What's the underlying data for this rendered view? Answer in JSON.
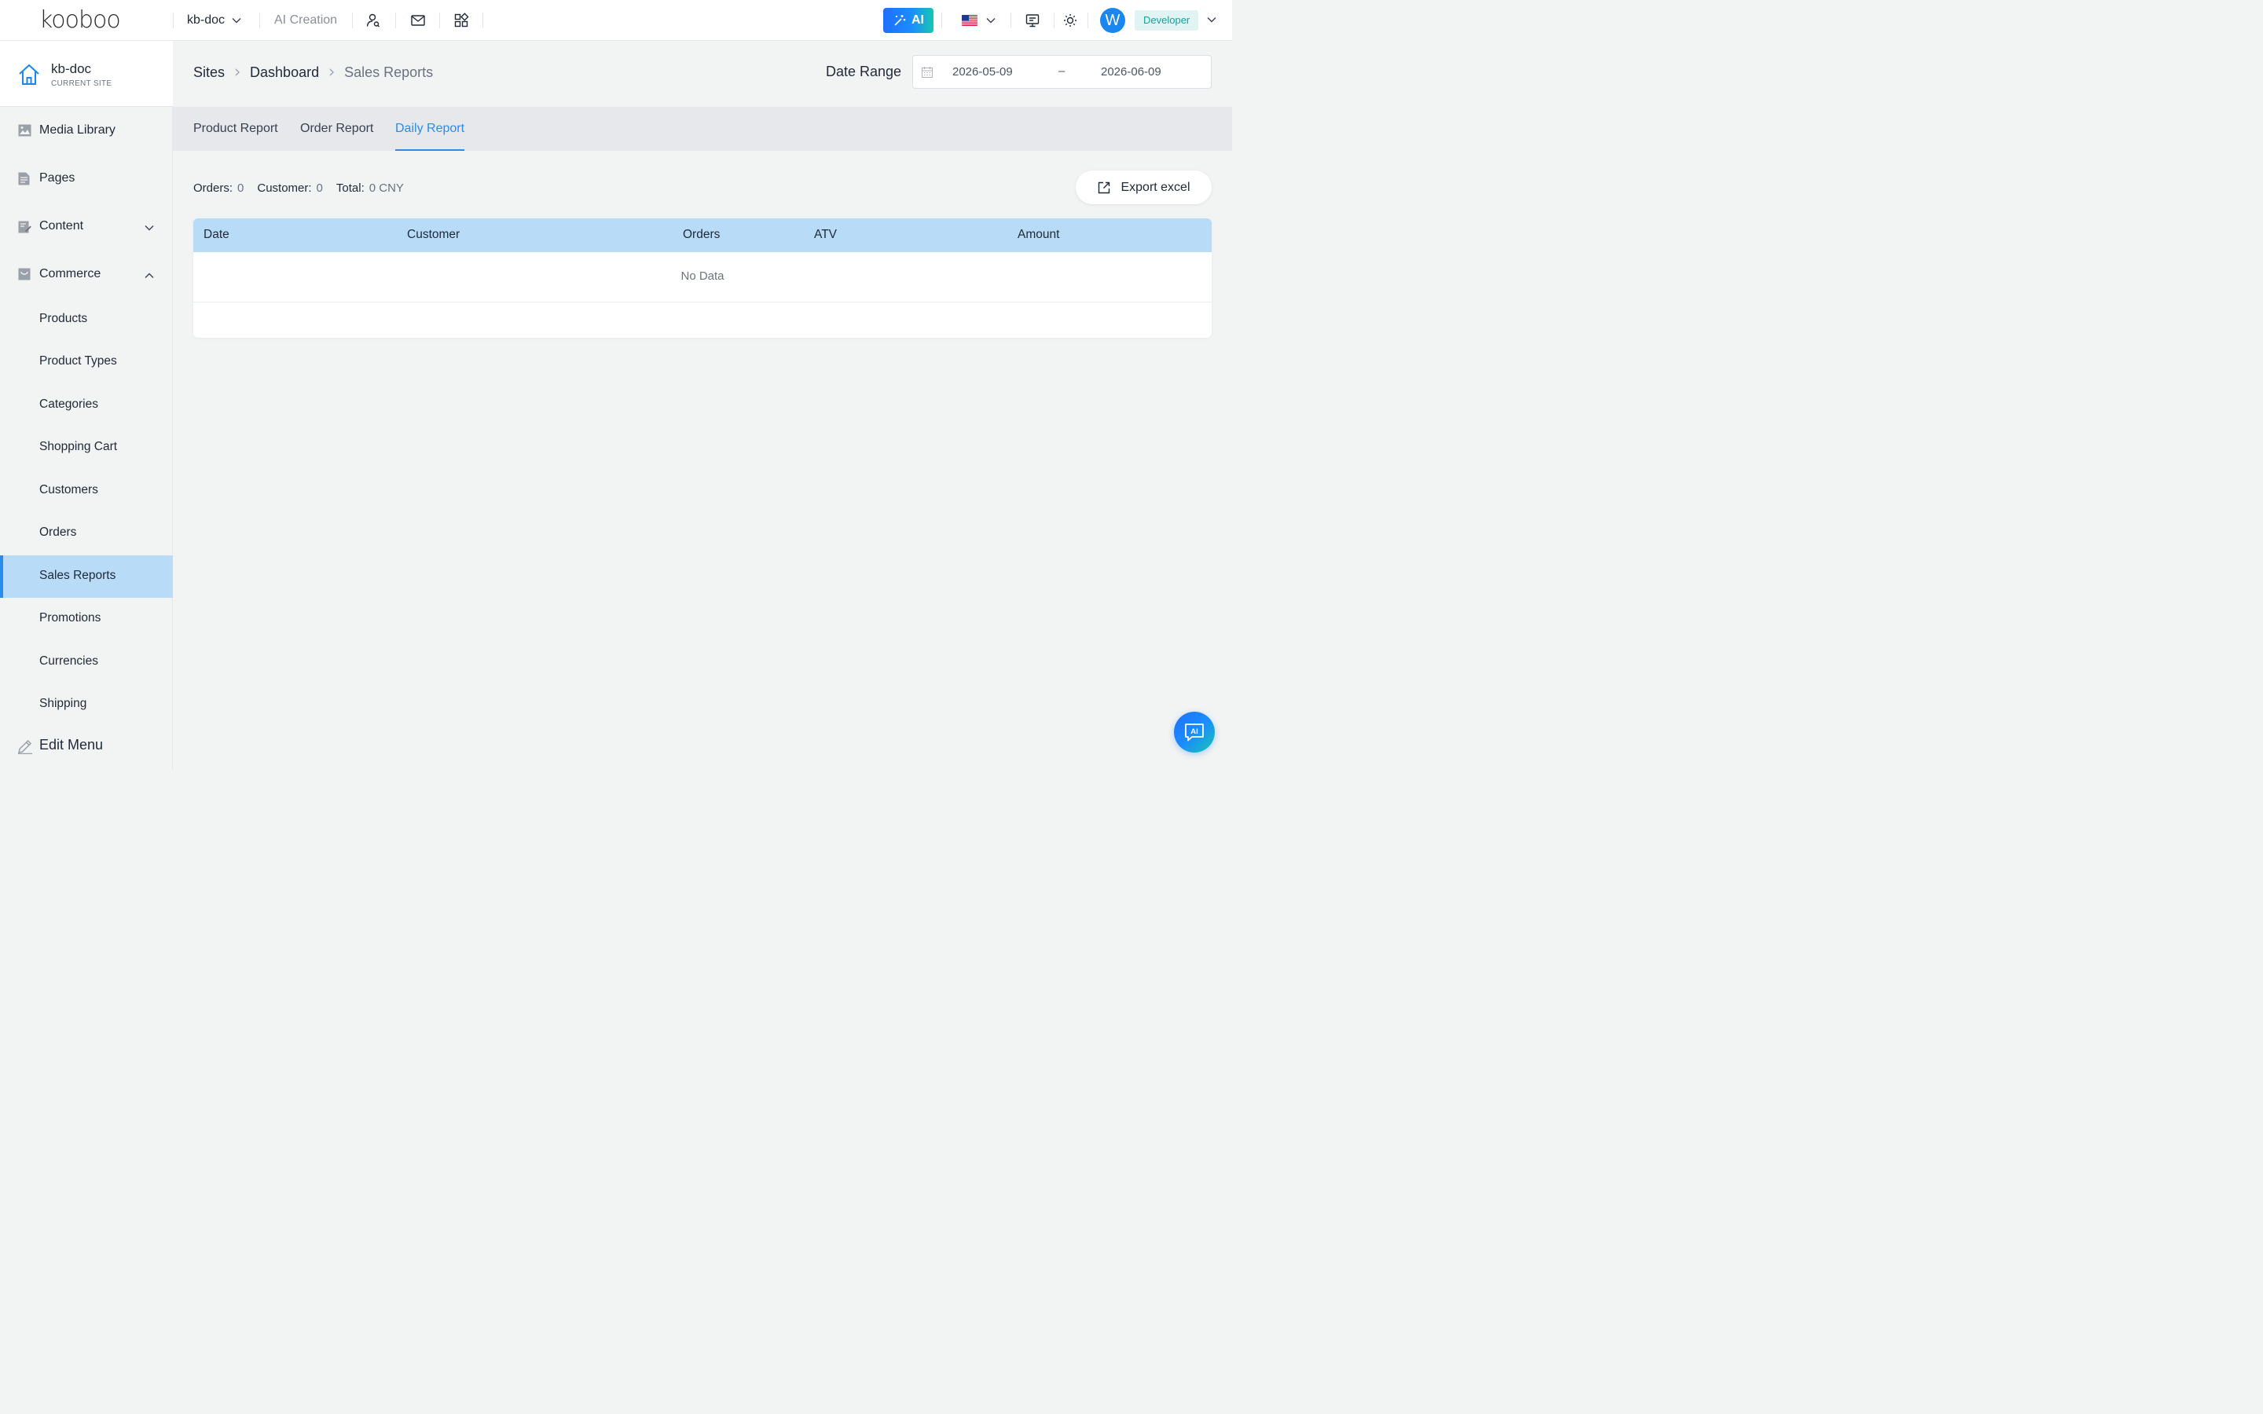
{
  "header": {
    "logo": "kooboo",
    "site_selector": "kb-doc",
    "ai_creation": "AI Creation",
    "ai_button": "AI",
    "user_initial": "W",
    "role": "Developer",
    "accent": "#1a86f0"
  },
  "sidebar": {
    "current_site": {
      "name": "kb-doc",
      "caption": "CURRENT SITE"
    },
    "items": [
      {
        "label": "Media Library",
        "icon": "image-icon"
      },
      {
        "label": "Pages",
        "icon": "document-icon"
      },
      {
        "label": "Content",
        "icon": "edit-document-icon",
        "expanded": false
      },
      {
        "label": "Commerce",
        "icon": "shop-icon",
        "expanded": true
      }
    ],
    "commerce_items": [
      "Products",
      "Product Types",
      "Categories",
      "Shopping Cart",
      "Customers",
      "Orders",
      "Sales Reports",
      "Promotions",
      "Currencies",
      "Shipping"
    ],
    "active_item": "Sales Reports",
    "edit_menu": "Edit Menu"
  },
  "breadcrumb": {
    "items": [
      "Sites",
      "Dashboard"
    ],
    "current": "Sales Reports"
  },
  "date_range": {
    "label": "Date Range",
    "start": "2026-05-09",
    "separator": "–",
    "end": "2026-06-09"
  },
  "tabs": [
    {
      "label": "Product Report",
      "active": false
    },
    {
      "label": "Order Report",
      "active": false
    },
    {
      "label": "Daily Report",
      "active": true
    }
  ],
  "summary": {
    "orders_label": "Orders:",
    "orders_value": "0",
    "customer_label": "Customer:",
    "customer_value": "0",
    "total_label": "Total:",
    "total_value": "0 CNY"
  },
  "export_button": "Export excel",
  "table": {
    "columns": [
      "Date",
      "Customer",
      "Orders",
      "ATV",
      "Amount"
    ],
    "empty_text": "No Data"
  },
  "ai_float": "AI"
}
